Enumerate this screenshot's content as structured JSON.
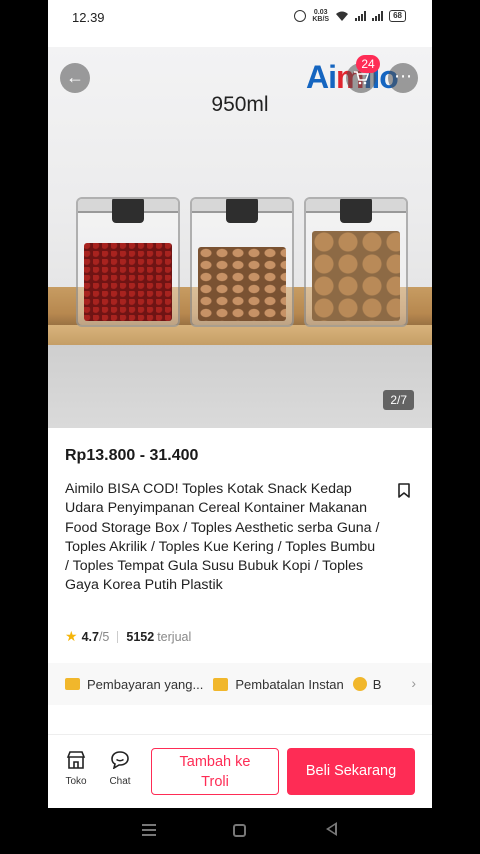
{
  "status_bar": {
    "time": "12.39",
    "net_speed_value": "0.03",
    "net_speed_unit": "KB/S",
    "battery": "68"
  },
  "hero": {
    "volume_label": "950ml",
    "page_indicator": "2/7",
    "cart_count": "24",
    "brand_left": "Ai",
    "brand_mid": "m",
    "brand_right": "ilo"
  },
  "product": {
    "price": "Rp13.800 - 31.400",
    "title": "Aimilo BISA COD! Toples Kotak Snack Kedap Udara Penyimpanan Cereal Kontainer Makanan Food Storage Box / Toples Aesthetic serba Guna / Toples Akrilik / Toples Kue Kering / Toples Bumbu / Toples Tempat Gula Susu Bubuk Kopi / Toples Gaya Korea Putih  Plastik",
    "rating": "4.7",
    "rating_max": "/5",
    "sold_count": "5152",
    "sold_label": "terjual"
  },
  "benefits": {
    "payment": "Pembayaran yang...",
    "cancel": "Pembatalan Instan",
    "third": "B"
  },
  "bottom_bar": {
    "toko_label": "Toko",
    "chat_label": "Chat",
    "add_to_cart_line1": "Tambah ke",
    "add_to_cart_line2": "Troli",
    "buy_now": "Beli Sekarang"
  },
  "colors": {
    "accent": "#fe2c55",
    "star": "#f5b50a",
    "benefit_icon": "#f1b72c"
  }
}
